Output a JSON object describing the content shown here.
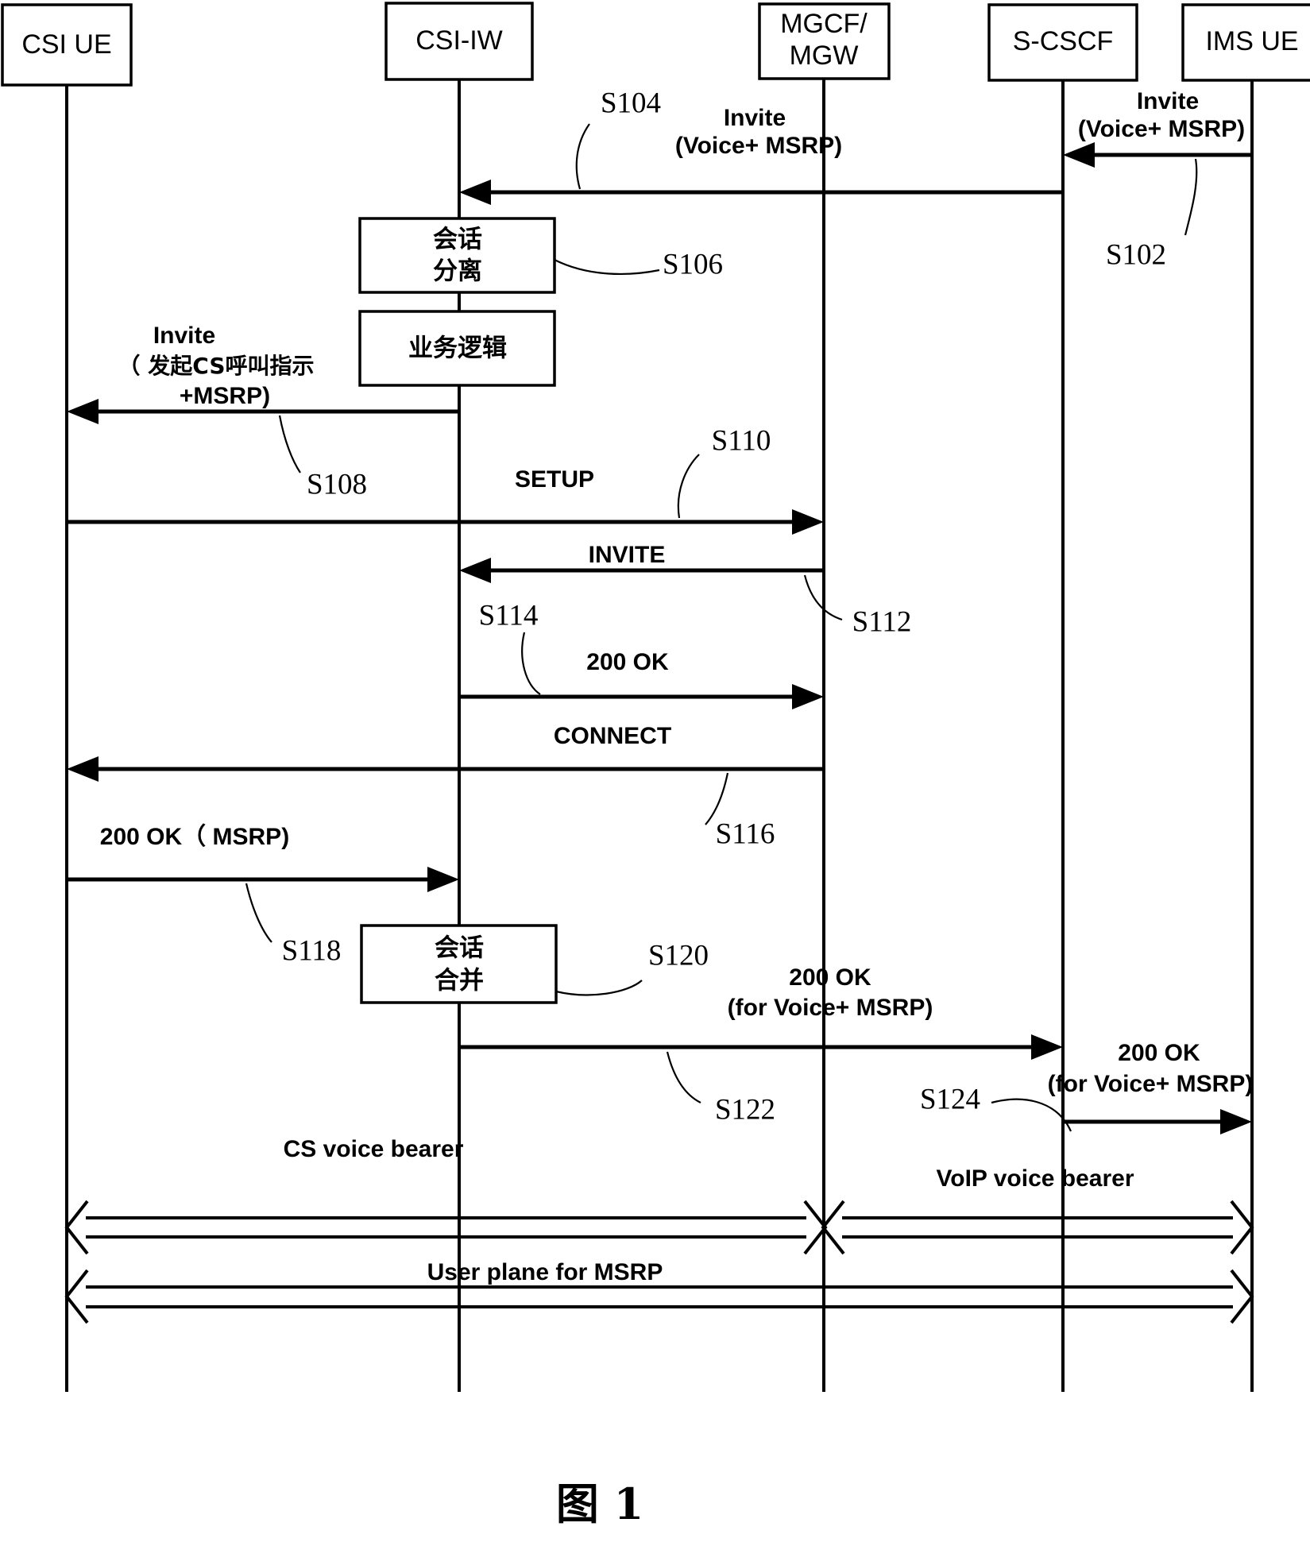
{
  "figure": {
    "caption": "图 1",
    "title": "CSI UE to IMS UE session establishment sequence"
  },
  "lanes": [
    {
      "id": "csi-ue",
      "label": "CSI UE",
      "label2": ""
    },
    {
      "id": "csi-iw",
      "label": "CSI-IW",
      "label2": ""
    },
    {
      "id": "mgcf-mgw",
      "label": "MGCF/",
      "label2": "MGW"
    },
    {
      "id": "s-cscf",
      "label": "S-CSCF",
      "label2": ""
    },
    {
      "id": "ims-ue",
      "label": "IMS UE",
      "label2": ""
    }
  ],
  "messages": [
    {
      "id": "m-s102",
      "step": "S102",
      "label_line1": "Invite",
      "label_line2": "(Voice+ MSRP)",
      "from": "ims-ue",
      "to": "s-cscf"
    },
    {
      "id": "m-s104",
      "step": "S104",
      "label_line1": "Invite",
      "label_line2": "(Voice+ MSRP)",
      "from": "s-cscf",
      "to": "csi-iw"
    },
    {
      "id": "m-s108",
      "step": "S108",
      "label_line1": "Invite",
      "label_line2": "（ 发起CS呼叫指示",
      "label_line3": "+MSRP)",
      "from": "csi-iw",
      "to": "csi-ue"
    },
    {
      "id": "m-s110",
      "step": "S110",
      "label_line1": "SETUP",
      "from": "csi-ue",
      "to": "mgcf-mgw"
    },
    {
      "id": "m-s112",
      "step": "S112",
      "label_line1": "INVITE",
      "from": "mgcf-mgw",
      "to": "csi-iw"
    },
    {
      "id": "m-s114",
      "step": "S114",
      "label_line1": "200 OK",
      "from": "csi-iw",
      "to": "mgcf-mgw"
    },
    {
      "id": "m-s116",
      "step": "S116",
      "label_line1": "CONNECT",
      "from": "mgcf-mgw",
      "to": "csi-ue"
    },
    {
      "id": "m-s118",
      "step": "S118",
      "label_line1": "200 OK（ MSRP)",
      "from": "csi-ue",
      "to": "csi-iw"
    },
    {
      "id": "m-s122",
      "step": "S122",
      "label_line1": "200 OK",
      "label_line2": "(for Voice+ MSRP)",
      "from": "csi-iw",
      "to": "s-cscf"
    },
    {
      "id": "m-s124",
      "step": "S124",
      "label_line1": "200 OK",
      "label_line2": "(for Voice+ MSRP)",
      "from": "s-cscf",
      "to": "ims-ue"
    }
  ],
  "process_boxes": [
    {
      "id": "p-s106",
      "step": "S106",
      "line1": "会话",
      "line2": "分离",
      "lane": "csi-iw"
    },
    {
      "id": "p-logic",
      "step": "",
      "line1": "业务逻辑",
      "line2": "",
      "lane": "csi-iw"
    },
    {
      "id": "p-s120",
      "step": "S120",
      "line1": "会话",
      "line2": "合并",
      "lane": "csi-iw"
    }
  ],
  "bearers": [
    {
      "id": "b-cs-voice",
      "label": "CS voice bearer",
      "from": "csi-ue",
      "to": "mgcf-mgw"
    },
    {
      "id": "b-voip",
      "label": "VoIP voice bearer",
      "from": "mgcf-mgw",
      "to": "ims-ue"
    },
    {
      "id": "b-msrp",
      "label": "User plane for MSRP",
      "from": "csi-ue",
      "to": "ims-ue"
    }
  ],
  "colors": {
    "ink": "#000000",
    "paper": "#ffffff"
  }
}
